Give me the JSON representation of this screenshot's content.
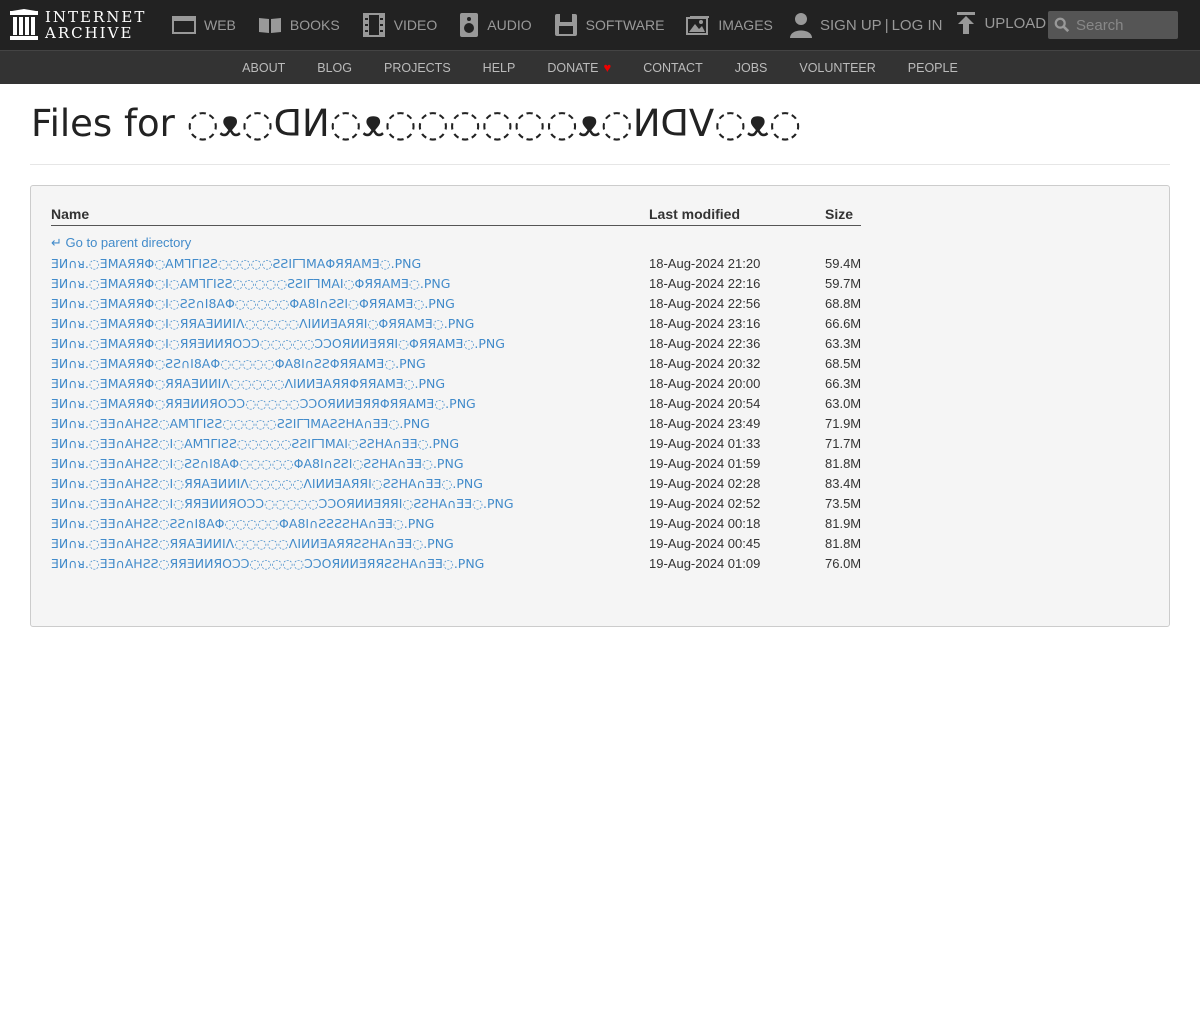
{
  "brand": {
    "line1": "INTERNET",
    "line2": "ARCHIVE"
  },
  "topnav": {
    "items": [
      {
        "label": "WEB",
        "icon": "web-icon"
      },
      {
        "label": "BOOKS",
        "icon": "books-icon"
      },
      {
        "label": "VIDEO",
        "icon": "video-icon"
      },
      {
        "label": "AUDIO",
        "icon": "audio-icon"
      },
      {
        "label": "SOFTWARE",
        "icon": "software-icon"
      },
      {
        "label": "IMAGES",
        "icon": "images-icon"
      }
    ],
    "sign_up": "SIGN UP",
    "separator": "|",
    "log_in": "LOG IN",
    "upload": "UPLOAD",
    "search_placeholder": "Search"
  },
  "subnav": {
    "about": "ABOUT",
    "blog": "BLOG",
    "projects": "PROJECTS",
    "help": "HELP",
    "donate": "DONATE",
    "donate_heart": "♥",
    "contact": "CONTACT",
    "jobs": "JOBS",
    "volunteer": "VOLUNTEER",
    "people": "PEOPLE"
  },
  "page": {
    "title": "Files for ◌ᴥ◌ᗡИ◌ᴥ◌◌◌◌◌◌ᴥ◌ИᗡV◌ᴥ◌"
  },
  "table": {
    "headers": {
      "name": "Name",
      "modified": "Last modified",
      "size": "Size"
    },
    "parent": "↵ Go to parent directory",
    "rows": [
      {
        "name": "ƎИ∩ᴚ.◌ƎMAЯЯΦ◌AMꞀΓIƧƧ◌◌◌◌◌ƧƧIΓꞀMAΦЯЯAMƎ◌.PNG",
        "date": "18-Aug-2024 21:20",
        "size": "59.4M"
      },
      {
        "name": "ƎИ∩ᴚ.◌ƎMAЯЯΦ◌I◌AMꞀΓIƧƧ◌◌◌◌◌ƧƧIΓꞀMAI◌ΦЯЯAMƎ◌.PNG",
        "date": "18-Aug-2024 22:16",
        "size": "59.7M"
      },
      {
        "name": "ƎИ∩ᴚ.◌ƎMAЯЯΦ◌I◌ƧƧ∩I8AΦ◌◌◌◌◌ΦA8I∩ƧƧI◌ΦЯЯAMƎ◌.PNG",
        "date": "18-Aug-2024 22:56",
        "size": "68.8M"
      },
      {
        "name": "ƎИ∩ᴚ.◌ƎMAЯЯΦ◌I◌ЯЯAƎИИIΛ◌◌◌◌◌ΛIИИƎAЯЯI◌ΦЯЯAMƎ◌.PNG",
        "date": "18-Aug-2024 23:16",
        "size": "66.6M"
      },
      {
        "name": "ƎИ∩ᴚ.◌ƎMAЯЯΦ◌I◌ЯЯƎИИЯOƆƆ◌◌◌◌◌ƆƆOЯИИƎЯЯI◌ΦЯЯAMƎ◌.PNG",
        "date": "18-Aug-2024 22:36",
        "size": "63.3M"
      },
      {
        "name": "ƎИ∩ᴚ.◌ƎMAЯЯΦ◌ƧƧ∩I8AΦ◌◌◌◌◌ΦA8I∩ƧƧΦЯЯAMƎ◌.PNG",
        "date": "18-Aug-2024 20:32",
        "size": "68.5M"
      },
      {
        "name": "ƎИ∩ᴚ.◌ƎMAЯЯΦ◌ЯЯAƎИИIΛ◌◌◌◌◌ΛIИИƎAЯЯΦЯЯAMƎ◌.PNG",
        "date": "18-Aug-2024 20:00",
        "size": "66.3M"
      },
      {
        "name": "ƎИ∩ᴚ.◌ƎMAЯЯΦ◌ЯЯƎИИЯOƆƆ◌◌◌◌◌ƆƆOЯИИƎЯЯΦЯЯAMƎ◌.PNG",
        "date": "18-Aug-2024 20:54",
        "size": "63.0M"
      },
      {
        "name": "ƎИ∩ᴚ.◌ƎƎ∩AHƧƧ◌AMꞀΓIƧƧ◌◌◌◌◌ƧƧIΓꞀMAƧƧHA∩ƎƎ◌.PNG",
        "date": "18-Aug-2024 23:49",
        "size": "71.9M"
      },
      {
        "name": "ƎИ∩ᴚ.◌ƎƎ∩AHƧƧ◌I◌AMꞀΓIƧƧ◌◌◌◌◌ƧƧIΓꞀMAI◌ƧƧHA∩ƎƎ◌.PNG",
        "date": "19-Aug-2024 01:33",
        "size": "71.7M"
      },
      {
        "name": "ƎИ∩ᴚ.◌ƎƎ∩AHƧƧ◌I◌ƧƧ∩I8AΦ◌◌◌◌◌ΦA8I∩ƧƧI◌ƧƧHA∩ƎƎ◌.PNG",
        "date": "19-Aug-2024 01:59",
        "size": "81.8M"
      },
      {
        "name": "ƎИ∩ᴚ.◌ƎƎ∩AHƧƧ◌I◌ЯЯAƎИИIΛ◌◌◌◌◌ΛIИИƎAЯЯI◌ƧƧHA∩ƎƎ◌.PNG",
        "date": "19-Aug-2024 02:28",
        "size": "83.4M"
      },
      {
        "name": "ƎИ∩ᴚ.◌ƎƎ∩AHƧƧ◌I◌ЯЯƎИИЯOƆƆ◌◌◌◌◌ƆƆOЯИИƎЯЯI◌ƧƧHA∩ƎƎ◌.PNG",
        "date": "19-Aug-2024 02:52",
        "size": "73.5M"
      },
      {
        "name": "ƎИ∩ᴚ.◌ƎƎ∩AHƧƧ◌ƧƧ∩I8AΦ◌◌◌◌◌ΦA8I∩ƧƧƧƧHA∩ƎƎ◌.PNG",
        "date": "19-Aug-2024 00:18",
        "size": "81.9M"
      },
      {
        "name": "ƎИ∩ᴚ.◌ƎƎ∩AHƧƧ◌ЯЯAƎИИIΛ◌◌◌◌◌ΛIИИƎAЯЯƧƧHA∩ƎƎ◌.PNG",
        "date": "19-Aug-2024 00:45",
        "size": "81.8M"
      },
      {
        "name": "ƎИ∩ᴚ.◌ƎƎ∩AHƧƧ◌ЯЯƎИИЯOƆƆ◌◌◌◌◌ƆƆOЯИИƎЯЯƧƧHA∩ƎƎ◌.PNG",
        "date": "19-Aug-2024 01:09",
        "size": "76.0M"
      }
    ]
  }
}
